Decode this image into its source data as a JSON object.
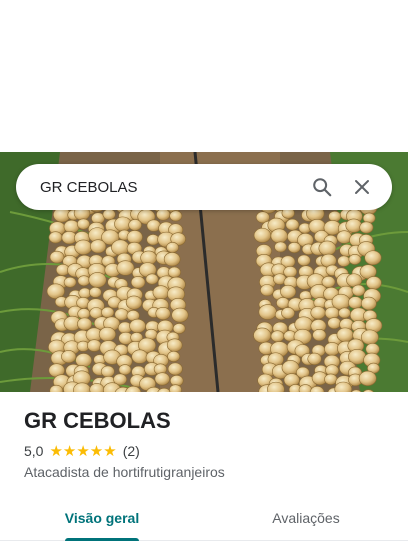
{
  "search": {
    "query": "GR CEBOLAS"
  },
  "place": {
    "name": "GR CEBOLAS",
    "rating": "5,0",
    "stars": "★★★★★",
    "review_count": "(2)",
    "category": "Atacadista de hortifrutigranjeiros"
  },
  "tabs": [
    {
      "label": "Visão geral",
      "active": true
    },
    {
      "label": "Avaliações",
      "active": false
    }
  ],
  "colors": {
    "accent": "#00737a",
    "star": "#fbbc04"
  }
}
